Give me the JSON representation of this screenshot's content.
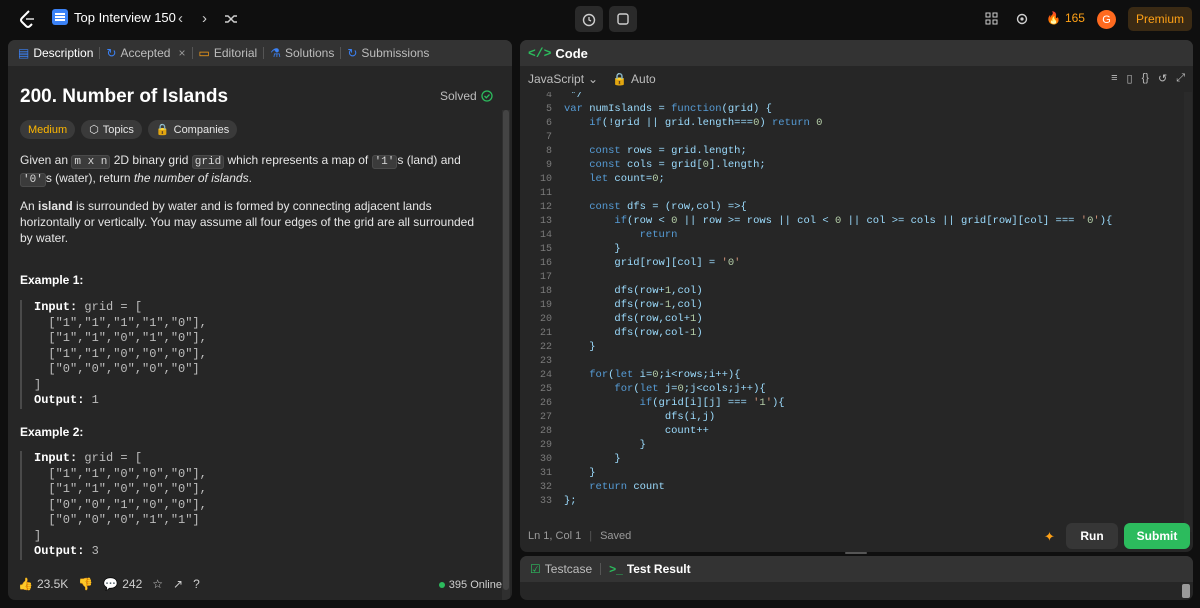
{
  "topbar": {
    "list_title": "Top Interview 150",
    "streak_count": "165",
    "avatar_letter": "G",
    "premium_label": "Premium"
  },
  "left_tabs": [
    {
      "label": "Description"
    },
    {
      "label": "Accepted"
    },
    {
      "label": "Editorial"
    },
    {
      "label": "Solutions"
    },
    {
      "label": "Submissions"
    }
  ],
  "problem": {
    "title": "200. Number of Islands",
    "solved_label": "Solved",
    "difficulty": "Medium",
    "topics_label": "Topics",
    "companies_label": "Companies",
    "p1_a": "Given an ",
    "p1_code1": "m x n",
    "p1_b": " 2D binary grid ",
    "p1_code2": "grid",
    "p1_c": " which represents a map of ",
    "p1_code3": "'1'",
    "p1_d": "s (land) and ",
    "p1_code4": "'0'",
    "p1_e": "s (water), return ",
    "p1_f": "the number of islands",
    "p1_g": ".",
    "p2_a": "An ",
    "p2_b": "island",
    "p2_c": " is surrounded by water and is formed by connecting adjacent lands horizontally or vertically. You may assume all four edges of the grid are all surrounded by water.",
    "ex1_title": "Example 1:",
    "ex2_title": "Example 2:",
    "input_label": "Input:",
    "output_label": "Output:",
    "ex1_input_head": " grid = [",
    "ex1_rows": "  [\"1\",\"1\",\"1\",\"1\",\"0\"],\n  [\"1\",\"1\",\"0\",\"1\",\"0\"],\n  [\"1\",\"1\",\"0\",\"0\",\"0\"],\n  [\"0\",\"0\",\"0\",\"0\",\"0\"]\n]",
    "ex1_output": " 1",
    "ex2_input_head": " grid = [",
    "ex2_rows": "  [\"1\",\"1\",\"0\",\"0\",\"0\"],\n  [\"1\",\"1\",\"0\",\"0\",\"0\"],\n  [\"0\",\"0\",\"1\",\"0\",\"0\"],\n  [\"0\",\"0\",\"0\",\"1\",\"1\"]\n]",
    "ex2_output": " 3"
  },
  "left_footer": {
    "likes": "23.5K",
    "comments": "242",
    "online": "395 Online"
  },
  "code_panel": {
    "title": "Code",
    "language": "JavaScript",
    "mode": "Auto",
    "cursor_pos": "Ln 1, Col 1",
    "status": "Saved",
    "run_label": "Run",
    "submit_label": "Submit"
  },
  "code_lines": [
    {
      "n": "4",
      "t": " */"
    },
    {
      "n": "5",
      "t": "var numIslands = function(grid) {"
    },
    {
      "n": "6",
      "t": "    if(!grid || grid.length===0) return 0"
    },
    {
      "n": "7",
      "t": ""
    },
    {
      "n": "8",
      "t": "    const rows = grid.length;"
    },
    {
      "n": "9",
      "t": "    const cols = grid[0].length;"
    },
    {
      "n": "10",
      "t": "    let count=0;"
    },
    {
      "n": "11",
      "t": ""
    },
    {
      "n": "12",
      "t": "    const dfs = (row,col) =>{"
    },
    {
      "n": "13",
      "t": "        if(row < 0 || row >= rows || col < 0 || col >= cols || grid[row][col] === '0'){"
    },
    {
      "n": "14",
      "t": "            return"
    },
    {
      "n": "15",
      "t": "        }"
    },
    {
      "n": "16",
      "t": "        grid[row][col] = '0'"
    },
    {
      "n": "17",
      "t": ""
    },
    {
      "n": "18",
      "t": "        dfs(row+1,col)"
    },
    {
      "n": "19",
      "t": "        dfs(row-1,col)"
    },
    {
      "n": "20",
      "t": "        dfs(row,col+1)"
    },
    {
      "n": "21",
      "t": "        dfs(row,col-1)"
    },
    {
      "n": "22",
      "t": "    }"
    },
    {
      "n": "23",
      "t": ""
    },
    {
      "n": "24",
      "t": "    for(let i=0;i<rows;i++){"
    },
    {
      "n": "25",
      "t": "        for(let j=0;j<cols;j++){"
    },
    {
      "n": "26",
      "t": "            if(grid[i][j] === '1'){"
    },
    {
      "n": "27",
      "t": "                dfs(i,j)"
    },
    {
      "n": "28",
      "t": "                count++"
    },
    {
      "n": "29",
      "t": "            }"
    },
    {
      "n": "30",
      "t": "        }"
    },
    {
      "n": "31",
      "t": "    }"
    },
    {
      "n": "32",
      "t": "    return count"
    },
    {
      "n": "33",
      "t": "};"
    }
  ],
  "result_tabs": {
    "testcase": "Testcase",
    "test_result": "Test Result"
  },
  "colors": {
    "accent": "#ffa116",
    "submit": "#2cbb5d",
    "medium": "#ffb800"
  }
}
